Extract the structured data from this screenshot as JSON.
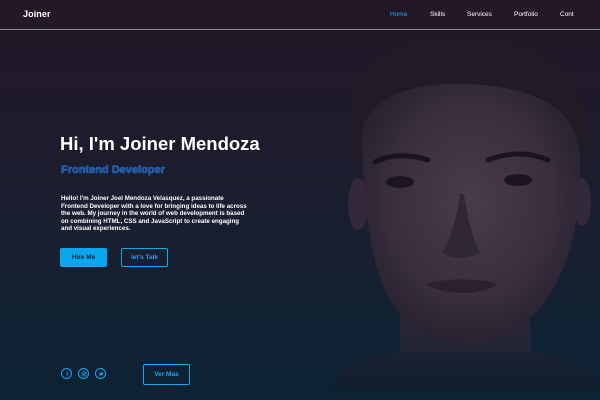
{
  "nav": {
    "brand": "Joiner",
    "links": [
      {
        "label": "Home",
        "active": true
      },
      {
        "label": "Skills",
        "active": false
      },
      {
        "label": "Services",
        "active": false
      },
      {
        "label": "Portfolio",
        "active": false
      },
      {
        "label": "Cont",
        "active": false
      }
    ]
  },
  "hero": {
    "title": "Hi, I'm Joiner Mendoza",
    "subtitle": "Frontend Developer",
    "bio": "Hello! I'm Joiner Joel Mendoza Velasquez, a passionate Frontend Developer with a love for bringing ideas to life across the web. My journey in the world of web development is based on combining HTML, CSS and JavaScript to create engaging and visual experiences.",
    "primary_button": "Hire Me",
    "secondary_button": "let's Talk",
    "more_button": "Ver Mas"
  },
  "social": [
    {
      "icon": "facebook-icon"
    },
    {
      "icon": "instagram-icon"
    },
    {
      "icon": "twitter-icon"
    }
  ],
  "colors": {
    "accent": "#1aa4ef",
    "subtitle": "#1a58a8",
    "primary_button_bg": "#0aa6ee"
  }
}
